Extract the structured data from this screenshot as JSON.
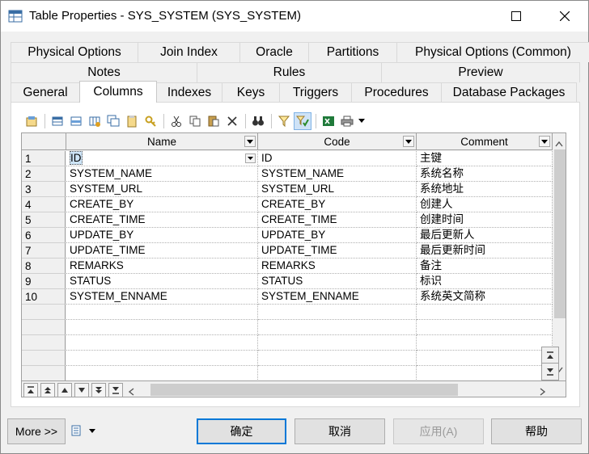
{
  "window": {
    "title": "Table Properties - SYS_SYSTEM (SYS_SYSTEM)"
  },
  "tabs": {
    "row1": [
      "Physical Options",
      "Join Index",
      "Oracle",
      "Partitions",
      "Physical Options (Common)"
    ],
    "row2": [
      "Notes",
      "Rules",
      "Preview"
    ],
    "row3": [
      "General",
      "Columns",
      "Indexes",
      "Keys",
      "Triggers",
      "Procedures",
      "Database Packages"
    ],
    "active": "Columns"
  },
  "grid": {
    "headers": [
      "Name",
      "Code",
      "Comment"
    ],
    "rows": [
      {
        "n": "1",
        "name": "ID",
        "code": "ID",
        "comment": "主键"
      },
      {
        "n": "2",
        "name": "SYSTEM_NAME",
        "code": "SYSTEM_NAME",
        "comment": "系统名称"
      },
      {
        "n": "3",
        "name": "SYSTEM_URL",
        "code": "SYSTEM_URL",
        "comment": "系统地址"
      },
      {
        "n": "4",
        "name": "CREATE_BY",
        "code": "CREATE_BY",
        "comment": "创建人"
      },
      {
        "n": "5",
        "name": "CREATE_TIME",
        "code": "CREATE_TIME",
        "comment": "创建时间"
      },
      {
        "n": "6",
        "name": "UPDATE_BY",
        "code": "UPDATE_BY",
        "comment": "最后更新人"
      },
      {
        "n": "7",
        "name": "UPDATE_TIME",
        "code": "UPDATE_TIME",
        "comment": "最后更新时间"
      },
      {
        "n": "8",
        "name": "REMARKS",
        "code": "REMARKS",
        "comment": "备注"
      },
      {
        "n": "9",
        "name": "STATUS",
        "code": "STATUS",
        "comment": "标识"
      },
      {
        "n": "10",
        "name": "SYSTEM_ENNAME",
        "code": "SYSTEM_ENNAME",
        "comment": "系统英文简称"
      }
    ],
    "empty_rows": 6
  },
  "buttons": {
    "more": "More >>",
    "ok": "确定",
    "cancel": "取消",
    "apply": "应用(A)",
    "help": "帮助"
  },
  "colors": {
    "accent": "#0078d7",
    "selection": "#cde4f7"
  }
}
